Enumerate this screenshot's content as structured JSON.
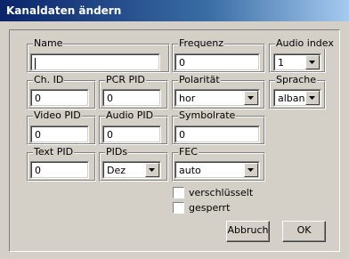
{
  "window": {
    "title": "Kanaldaten ändern"
  },
  "fields": {
    "name": {
      "label": "Name",
      "value": ""
    },
    "frequenz": {
      "label": "Frequenz",
      "value": "0"
    },
    "audio_index": {
      "label": "Audio index",
      "value": "1"
    },
    "ch_id": {
      "label": "Ch. ID",
      "value": "0"
    },
    "pcr_pid": {
      "label": "PCR PID",
      "value": "0"
    },
    "polaritaet": {
      "label": "Polarität",
      "value": "hor"
    },
    "sprache": {
      "label": "Sprache",
      "value": "alban."
    },
    "video_pid": {
      "label": "Video PID",
      "value": "0"
    },
    "audio_pid": {
      "label": "Audio PID",
      "value": "0"
    },
    "symbolrate": {
      "label": "Symbolrate",
      "value": "0"
    },
    "text_pid": {
      "label": "Text PID",
      "value": "0"
    },
    "pids": {
      "label": "PIDs",
      "value": "Dez"
    },
    "fec": {
      "label": "FEC",
      "value": "auto"
    }
  },
  "checkboxes": {
    "verschluesselt": {
      "label": "verschlüsselt",
      "checked": false
    },
    "gesperrt": {
      "label": "gesperrt",
      "checked": false
    }
  },
  "buttons": {
    "abbruch": "Abbruch",
    "ok": "OK"
  }
}
